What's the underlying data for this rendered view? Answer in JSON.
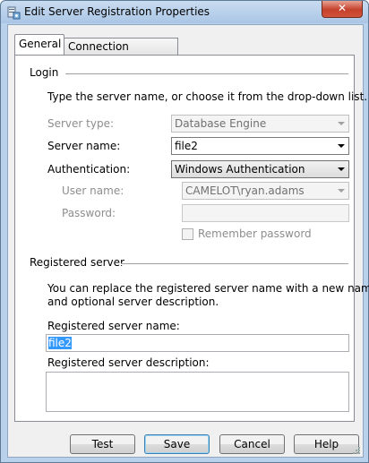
{
  "window": {
    "title": "Edit Server Registration Properties",
    "close_symbol": "✕"
  },
  "tabs": [
    {
      "label": "General",
      "selected": true
    },
    {
      "label": "Connection Properties",
      "selected": false
    }
  ],
  "login": {
    "section_title": "Login",
    "instructions": "Type the server name, or choose it from the drop-down list.",
    "server_type_label": "Server type:",
    "server_type_value": "Database Engine",
    "server_name_label": "Server name:",
    "server_name_value": "file2",
    "authentication_label": "Authentication:",
    "authentication_value": "Windows Authentication",
    "user_name_label": "User name:",
    "user_name_value": "CAMELOT\\ryan.adams",
    "password_label": "Password:",
    "password_value": "",
    "remember_password_label": "Remember password",
    "remember_password_checked": false
  },
  "registered": {
    "section_title": "Registered server",
    "instructions_line1": "You can replace the registered server name with a new name",
    "instructions_line2": "and optional server description.",
    "name_label": "Registered server name:",
    "name_value": "file2",
    "description_label": "Registered server description:",
    "description_value": ""
  },
  "buttons": {
    "test": "Test",
    "save": "Save",
    "cancel": "Cancel",
    "help": "Help"
  },
  "colors": {
    "titlebar": "#b9d1ea",
    "close": "#c5412b",
    "selection": "#3399ff"
  }
}
